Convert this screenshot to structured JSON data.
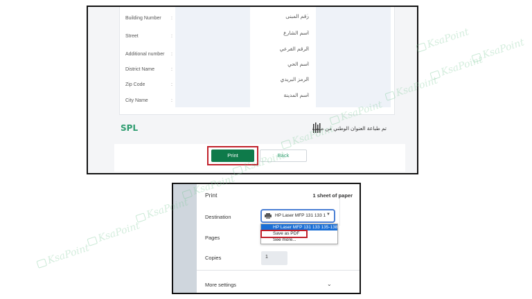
{
  "watermark_text": "KsaPoint",
  "address_form": {
    "labels_en": [
      "Building Number",
      "Street",
      "Additional number",
      "District Name",
      "Zip Code",
      "City Name"
    ],
    "labels_ar": [
      "رقم المبنى",
      "اسم الشارع",
      "الرقم الفرعي",
      "اسم الحي",
      "الرمز البريدي",
      "اسم المدينة"
    ],
    "colon": ":"
  },
  "footer": {
    "spl_logo_a": "SP",
    "spl_logo_b": "L",
    "note_ar": "تم طباعة العنوان الوطني من منصة"
  },
  "buttons": {
    "print": "Print",
    "back": "Back"
  },
  "print_dialog": {
    "title": "Print",
    "sheet_count": "1 sheet of paper",
    "destination_label": "Destination",
    "destination_value": "HP Laser MFP 131 133 1",
    "dropdown_options": [
      "HP Laser MFP 131 133 135-138",
      "Save as PDF",
      "See more..."
    ],
    "pages_label": "Pages",
    "copies_label": "Copies",
    "copies_value": "1",
    "more_settings": "More settings"
  },
  "colors": {
    "highlight": "#c0202a",
    "print_button": "#0e7a4a",
    "select_focus": "#4a7fd4",
    "selected_option": "#1a6fd6"
  }
}
